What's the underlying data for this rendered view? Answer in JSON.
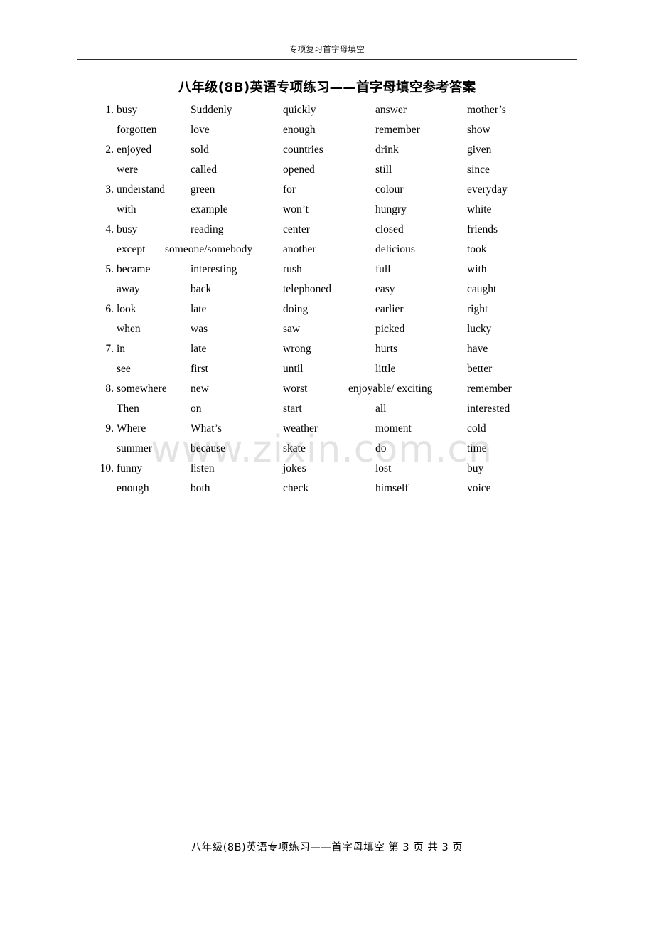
{
  "header": {
    "text": "专项复习首字母填空"
  },
  "title": "八年级(8B)英语专项练习——首字母填空参考答案",
  "watermark": "www.zixin.com.cn",
  "footer": {
    "text": "八年级(8B)英语专项练习——首字母填空  第 3 页 共 3 页"
  },
  "answers": {
    "rows": [
      {
        "num": "1.",
        "c0": "busy",
        "c1": "Suddenly",
        "c2": "quickly",
        "c3": "answer",
        "c4": "mother’s"
      },
      {
        "num": "",
        "c0": "forgotten",
        "c1": "love",
        "c2": "enough",
        "c3": "remember",
        "c4": "show"
      },
      {
        "num": "2.",
        "c0": "enjoyed",
        "c1": "sold",
        "c2": "countries",
        "c3": "drink",
        "c4": "given"
      },
      {
        "num": "",
        "c0": "were",
        "c1": "called",
        "c2": "opened",
        "c3": "still",
        "c4": "since"
      },
      {
        "num": "3.",
        "c0": "understand",
        "c1": "green",
        "c2": "for",
        "c3": "colour",
        "c4": "everyday"
      },
      {
        "num": "",
        "c0": "with",
        "c1": "example",
        "c2": "won’t",
        "c3": "hungry",
        "c4": "white"
      },
      {
        "num": "4.",
        "c0": "busy",
        "c1": "reading",
        "c2": "center",
        "c3": "closed",
        "c4": "friends"
      },
      {
        "num": "",
        "c0": "except",
        "c1": "someone/somebody",
        "c2": "another",
        "c3": "delicious",
        "c4": "took"
      },
      {
        "num": "5.",
        "c0": "became",
        "c1": "interesting",
        "c2": "rush",
        "c3": "full",
        "c4": "with"
      },
      {
        "num": "",
        "c0": "away",
        "c1": "back",
        "c2": "telephoned",
        "c3": "easy",
        "c4": "caught"
      },
      {
        "num": "6.",
        "c0": "look",
        "c1": "late",
        "c2": "doing",
        "c3": "earlier",
        "c4": "right"
      },
      {
        "num": "",
        "c0": "when",
        "c1": "was",
        "c2": "saw",
        "c3": "picked",
        "c4": "lucky"
      },
      {
        "num": "7.",
        "c0": "in",
        "c1": "late",
        "c2": "wrong",
        "c3": "hurts",
        "c4": "have"
      },
      {
        "num": "",
        "c0": "see",
        "c1": "first",
        "c2": "until",
        "c3": "little",
        "c4": "better"
      },
      {
        "num": "8.",
        "c0": "somewhere",
        "c1": "new",
        "c2": "worst",
        "c3": "enjoyable/ exciting",
        "c4": "remember"
      },
      {
        "num": "",
        "c0": "Then",
        "c1": "on",
        "c2": "start",
        "c3": "all",
        "c4": "interested"
      },
      {
        "num": "9.",
        "c0": "Where",
        "c1": "What’s",
        "c2": "weather",
        "c3": "moment",
        "c4": "cold"
      },
      {
        "num": "",
        "c0": "summer",
        "c1": "because",
        "c2": "skate",
        "c3": "do",
        "c4": "time"
      },
      {
        "num": "10.",
        "c0": "funny",
        "c1": "listen",
        "c2": "jokes",
        "c3": "lost",
        "c4": "buy"
      },
      {
        "num": "",
        "c0": "enough",
        "c1": "both",
        "c2": "check",
        "c3": "himself",
        "c4": "voice"
      }
    ]
  }
}
